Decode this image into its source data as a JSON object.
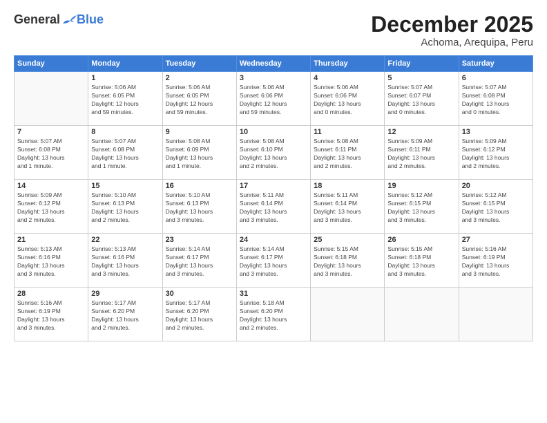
{
  "header": {
    "logo_general": "General",
    "logo_blue": "Blue",
    "month_title": "December 2025",
    "location": "Achoma, Arequipa, Peru"
  },
  "days_of_week": [
    "Sunday",
    "Monday",
    "Tuesday",
    "Wednesday",
    "Thursday",
    "Friday",
    "Saturday"
  ],
  "weeks": [
    [
      {
        "day": "",
        "info": ""
      },
      {
        "day": "1",
        "info": "Sunrise: 5:06 AM\nSunset: 6:05 PM\nDaylight: 12 hours\nand 59 minutes."
      },
      {
        "day": "2",
        "info": "Sunrise: 5:06 AM\nSunset: 6:05 PM\nDaylight: 12 hours\nand 59 minutes."
      },
      {
        "day": "3",
        "info": "Sunrise: 5:06 AM\nSunset: 6:06 PM\nDaylight: 12 hours\nand 59 minutes."
      },
      {
        "day": "4",
        "info": "Sunrise: 5:06 AM\nSunset: 6:06 PM\nDaylight: 13 hours\nand 0 minutes."
      },
      {
        "day": "5",
        "info": "Sunrise: 5:07 AM\nSunset: 6:07 PM\nDaylight: 13 hours\nand 0 minutes."
      },
      {
        "day": "6",
        "info": "Sunrise: 5:07 AM\nSunset: 6:08 PM\nDaylight: 13 hours\nand 0 minutes."
      }
    ],
    [
      {
        "day": "7",
        "info": "Sunrise: 5:07 AM\nSunset: 6:08 PM\nDaylight: 13 hours\nand 1 minute."
      },
      {
        "day": "8",
        "info": "Sunrise: 5:07 AM\nSunset: 6:08 PM\nDaylight: 13 hours\nand 1 minute."
      },
      {
        "day": "9",
        "info": "Sunrise: 5:08 AM\nSunset: 6:09 PM\nDaylight: 13 hours\nand 1 minute."
      },
      {
        "day": "10",
        "info": "Sunrise: 5:08 AM\nSunset: 6:10 PM\nDaylight: 13 hours\nand 2 minutes."
      },
      {
        "day": "11",
        "info": "Sunrise: 5:08 AM\nSunset: 6:11 PM\nDaylight: 13 hours\nand 2 minutes."
      },
      {
        "day": "12",
        "info": "Sunrise: 5:09 AM\nSunset: 6:11 PM\nDaylight: 13 hours\nand 2 minutes."
      },
      {
        "day": "13",
        "info": "Sunrise: 5:09 AM\nSunset: 6:12 PM\nDaylight: 13 hours\nand 2 minutes."
      }
    ],
    [
      {
        "day": "14",
        "info": "Sunrise: 5:09 AM\nSunset: 6:12 PM\nDaylight: 13 hours\nand 2 minutes."
      },
      {
        "day": "15",
        "info": "Sunrise: 5:10 AM\nSunset: 6:13 PM\nDaylight: 13 hours\nand 2 minutes."
      },
      {
        "day": "16",
        "info": "Sunrise: 5:10 AM\nSunset: 6:13 PM\nDaylight: 13 hours\nand 3 minutes."
      },
      {
        "day": "17",
        "info": "Sunrise: 5:11 AM\nSunset: 6:14 PM\nDaylight: 13 hours\nand 3 minutes."
      },
      {
        "day": "18",
        "info": "Sunrise: 5:11 AM\nSunset: 6:14 PM\nDaylight: 13 hours\nand 3 minutes."
      },
      {
        "day": "19",
        "info": "Sunrise: 5:12 AM\nSunset: 6:15 PM\nDaylight: 13 hours\nand 3 minutes."
      },
      {
        "day": "20",
        "info": "Sunrise: 5:12 AM\nSunset: 6:15 PM\nDaylight: 13 hours\nand 3 minutes."
      }
    ],
    [
      {
        "day": "21",
        "info": "Sunrise: 5:13 AM\nSunset: 6:16 PM\nDaylight: 13 hours\nand 3 minutes."
      },
      {
        "day": "22",
        "info": "Sunrise: 5:13 AM\nSunset: 6:16 PM\nDaylight: 13 hours\nand 3 minutes."
      },
      {
        "day": "23",
        "info": "Sunrise: 5:14 AM\nSunset: 6:17 PM\nDaylight: 13 hours\nand 3 minutes."
      },
      {
        "day": "24",
        "info": "Sunrise: 5:14 AM\nSunset: 6:17 PM\nDaylight: 13 hours\nand 3 minutes."
      },
      {
        "day": "25",
        "info": "Sunrise: 5:15 AM\nSunset: 6:18 PM\nDaylight: 13 hours\nand 3 minutes."
      },
      {
        "day": "26",
        "info": "Sunrise: 5:15 AM\nSunset: 6:18 PM\nDaylight: 13 hours\nand 3 minutes."
      },
      {
        "day": "27",
        "info": "Sunrise: 5:16 AM\nSunset: 6:19 PM\nDaylight: 13 hours\nand 3 minutes."
      }
    ],
    [
      {
        "day": "28",
        "info": "Sunrise: 5:16 AM\nSunset: 6:19 PM\nDaylight: 13 hours\nand 3 minutes."
      },
      {
        "day": "29",
        "info": "Sunrise: 5:17 AM\nSunset: 6:20 PM\nDaylight: 13 hours\nand 2 minutes."
      },
      {
        "day": "30",
        "info": "Sunrise: 5:17 AM\nSunset: 6:20 PM\nDaylight: 13 hours\nand 2 minutes."
      },
      {
        "day": "31",
        "info": "Sunrise: 5:18 AM\nSunset: 6:20 PM\nDaylight: 13 hours\nand 2 minutes."
      },
      {
        "day": "",
        "info": ""
      },
      {
        "day": "",
        "info": ""
      },
      {
        "day": "",
        "info": ""
      }
    ]
  ]
}
